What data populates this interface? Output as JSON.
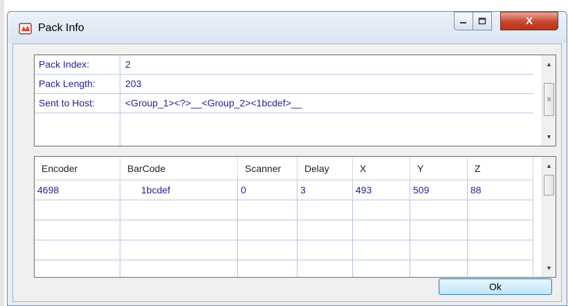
{
  "window": {
    "title": "Pack Info",
    "controls": {
      "minimize_icon": "minimize-icon",
      "maximize_icon": "maximize-icon",
      "close_label": "X"
    }
  },
  "info": {
    "rows": [
      {
        "label": "Pack Index:",
        "value": "2"
      },
      {
        "label": "Pack Length:",
        "value": "203"
      },
      {
        "label": "Sent to Host:",
        "value": "<Group_1><?>__<Group_2><1bcdef>__"
      },
      {
        "label": "",
        "value": ""
      }
    ]
  },
  "table": {
    "columns": [
      "Encoder",
      "BarCode",
      "Scanner",
      "Delay",
      "X",
      "Y",
      "Z"
    ],
    "rows": [
      [
        "4698",
        "1bcdef",
        "0",
        "3",
        "493",
        "509",
        "88"
      ],
      [
        "",
        "",
        "",
        "",
        "",
        "",
        ""
      ],
      [
        "",
        "",
        "",
        "",
        "",
        "",
        ""
      ],
      [
        "",
        "",
        "",
        "",
        "",
        "",
        ""
      ]
    ]
  },
  "ok_label": "Ok"
}
